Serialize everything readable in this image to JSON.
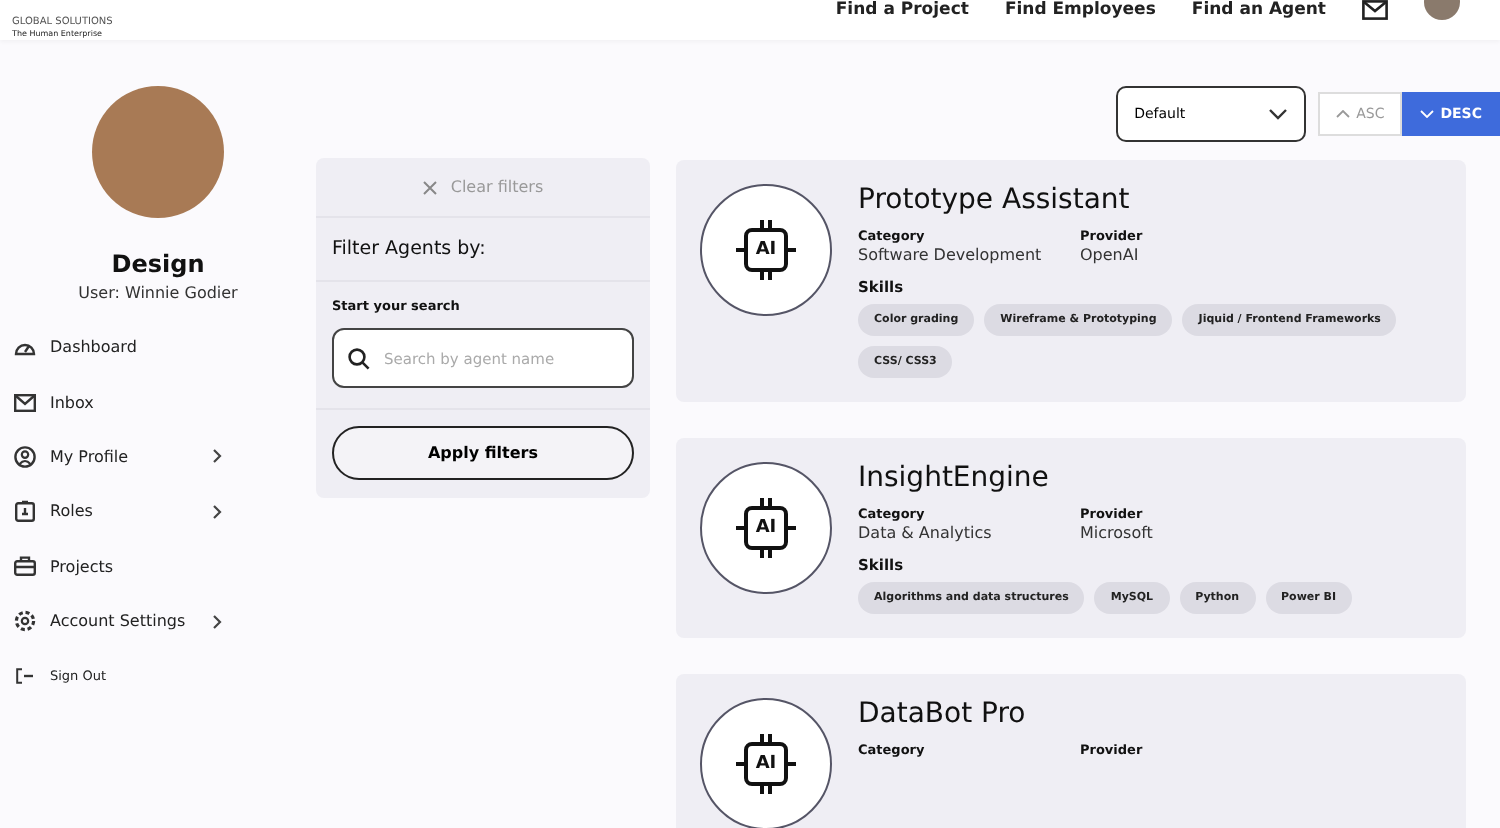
{
  "logo": {
    "line_1": "GLOBAL SOLUTIONS",
    "line_2": "The Human Enterprise"
  },
  "nav": [
    {
      "label": "Find a Project"
    },
    {
      "label": "Find Employees"
    },
    {
      "label": "Find an Agent"
    }
  ],
  "profile": {
    "title": "Design",
    "user": "User: Winnie Godier"
  },
  "sidebar": {
    "items": [
      {
        "label": "Dashboard",
        "expandable": false
      },
      {
        "label": "Inbox",
        "expandable": false
      },
      {
        "label": "My Profile",
        "expandable": true
      },
      {
        "label": "Roles",
        "expandable": true
      },
      {
        "label": "Projects",
        "expandable": false
      },
      {
        "label": "Account Settings",
        "expandable": true
      },
      {
        "label": "Sign Out",
        "expandable": false
      }
    ]
  },
  "sort": {
    "value": "Default",
    "orders": [
      {
        "label": "ASC",
        "selected": false
      },
      {
        "label": "DESC",
        "selected": true
      }
    ]
  },
  "filters": {
    "clear": "Clear filters",
    "title": "Filter Agents by:",
    "search_label": "Start your search",
    "placeholder": "Search by agent name",
    "apply": "Apply filters"
  },
  "agents": [
    {
      "name": "Prototype Assistant",
      "icon_text": "AI",
      "category_label": "Category",
      "category": "Software Development",
      "provider_label": "Provider",
      "provider": "OpenAI",
      "skills_label": "Skills",
      "skills": [
        "Color grading",
        "Wireframe & Prototyping",
        "Jiquid / Frontend Frameworks",
        "CSS/ CSS3"
      ]
    },
    {
      "name": "InsightEngine",
      "icon_text": "AI",
      "category_label": "Category",
      "category": "Data & Analytics",
      "provider_label": "Provider",
      "provider": "Microsoft",
      "skills_label": "Skills",
      "skills": [
        "Algorithms and data structures",
        "MySQL",
        "Python",
        "Power BI"
      ]
    },
    {
      "name": "DataBot Pro",
      "icon_text": "AI",
      "category_label": "Category",
      "provider_label": "Provider"
    }
  ]
}
